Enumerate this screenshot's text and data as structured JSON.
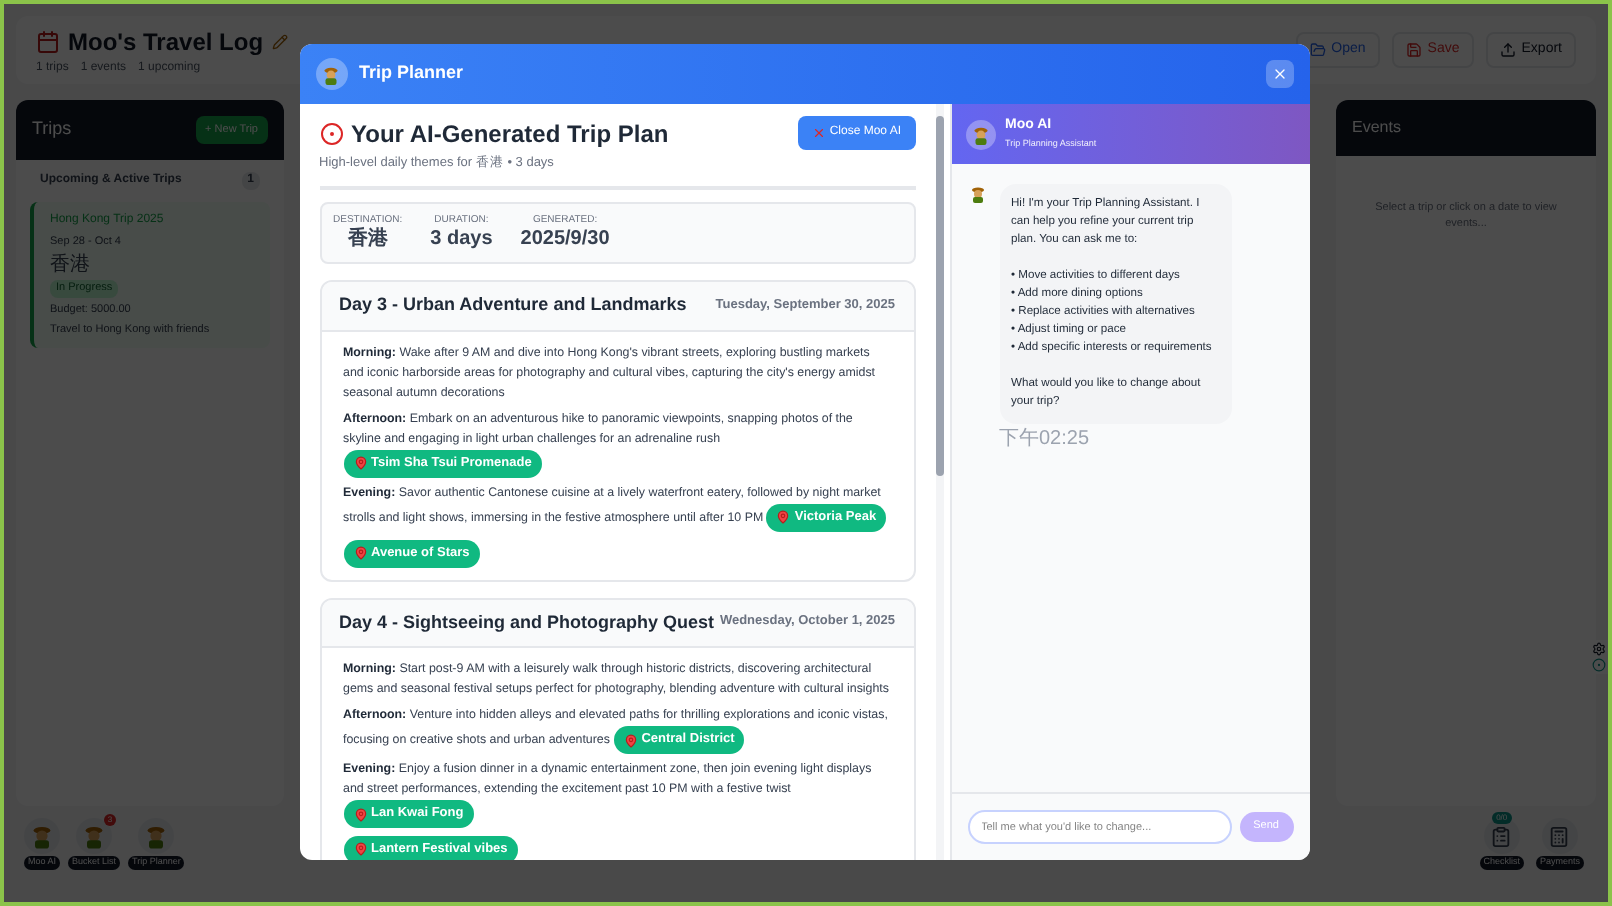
{
  "app": {
    "title": "Moo's Travel Log",
    "stats": [
      "1 trips",
      "1 events",
      "1 upcoming"
    ],
    "actions": [
      {
        "kind": "open",
        "label": "Open"
      },
      {
        "kind": "save",
        "label": "Save"
      },
      {
        "kind": "export",
        "label": "Export"
      }
    ]
  },
  "trips_panel": {
    "title": "Trips",
    "new_button": "+ New Trip",
    "section": "Upcoming & Active Trips",
    "count": "1",
    "trips": [
      {
        "name": "Hong Kong Trip 2025",
        "dates": "Sep 28 - Oct 4",
        "location": "香港",
        "status": "In Progress",
        "budget": "Budget: 5000.00",
        "description": "Travel to Hong Kong with friends",
        "selected": true
      }
    ]
  },
  "dock_left": [
    {
      "label": "Moo AI"
    },
    {
      "label": "Bucket List",
      "badge": "3"
    },
    {
      "label": "Trip Planner"
    }
  ],
  "events_panel": {
    "title": "Events",
    "empty": "Select a trip or click on a date to view events..."
  },
  "dock_right": [
    {
      "kind": "checklist",
      "label": "Checklist",
      "badge": "0/0"
    },
    {
      "kind": "payments",
      "label": "Payments"
    }
  ],
  "modal": {
    "title": "Trip Planner",
    "plan": {
      "title": "Your AI-Generated Trip Plan",
      "subtitle": "High-level daily themes for 香港 • 3 days",
      "close_button": "Close Moo AI",
      "summary": [
        {
          "label": "DESTINATION:",
          "value": "香港"
        },
        {
          "label": "DURATION:",
          "value": "3 days"
        },
        {
          "label": "GENERATED:",
          "value": "2025/9/30"
        }
      ],
      "days": [
        {
          "title": "Day 3 - Urban Adventure and Landmarks",
          "date": "Tuesday, September 30, 2025",
          "activities": [
            {
              "label": "Morning:",
              "text": "Wake after 9 AM and dive into Hong Kong's vibrant streets, exploring bustling markets and iconic harborside areas for photography and cultural vibes, capturing the city's energy amidst seasonal autumn decorations"
            },
            {
              "label": "Afternoon:",
              "text": "Embark on an adventurous hike to panoramic viewpoints, snapping photos of the skyline and engaging in light urban challenges for an adrenaline rush",
              "places": [
                "Tsim Sha Tsui Promenade"
              ]
            },
            {
              "label": "Evening:",
              "text": "Savor authentic Cantonese cuisine at a lively waterfront eatery, followed by night market strolls and light shows, immersing in the festive atmosphere until after 10 PM",
              "places": [
                "Victoria Peak"
              ]
            }
          ],
          "extra_places": [
            "Avenue of Stars"
          ]
        },
        {
          "title": "Day 4 - Sightseeing and Photography Quest",
          "date": "Wednesday, October 1, 2025",
          "activities": [
            {
              "label": "Morning:",
              "text": "Start post-9 AM with a leisurely walk through historic districts, discovering architectural gems and seasonal festival setups perfect for photography, blending adventure with cultural insights"
            },
            {
              "label": "Afternoon:",
              "text": "Venture into hidden alleys and elevated paths for thrilling explorations and iconic vistas, focusing on creative shots and urban adventures",
              "places": [
                "Central District"
              ]
            },
            {
              "label": "Evening:",
              "text": "Enjoy a fusion dinner in a dynamic entertainment zone, then join evening light displays and street performances, extending the excitement past 10 PM with a festive twist",
              "places": [
                "Lan Kwai Fong"
              ]
            }
          ],
          "extra_places": [
            "Lantern Festival vibes"
          ]
        }
      ]
    },
    "chat": {
      "name": "Moo AI",
      "role": "Trip Planning Assistant",
      "messages": [
        {
          "text": "Hi! I'm your Trip Planning Assistant. I can help you refine your current trip plan. You can ask me to:\n\n• Move activities to different days\n• Add more dining options\n• Replace activities with alternatives\n• Adjust timing or pace\n• Add specific interests or requirements\n\nWhat would you like to change about your trip?",
          "time": "下午02:25"
        }
      ],
      "input": {
        "placeholder": "Tell me what you'd like to change..."
      },
      "send": {
        "label": "Send",
        "disabled": true
      }
    }
  }
}
